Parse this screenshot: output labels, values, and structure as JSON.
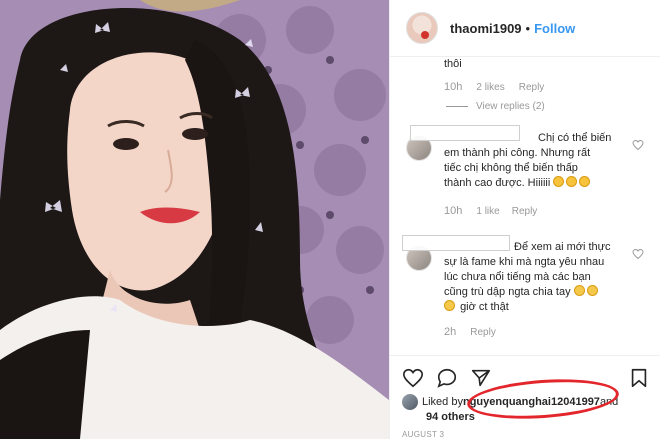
{
  "header": {
    "username": "thaomi1909",
    "separator": "•",
    "follow_label": "Follow"
  },
  "comments": [
    {
      "text_lines": [
        "thôi"
      ],
      "time": "10h",
      "likes": "2 likes",
      "reply": "Reply",
      "view_replies": "View replies (2)"
    },
    {
      "text_lines": [
        "Chị có thể biến",
        "em thành phi công. Nhưng rất",
        "tiếc chị không thể biến thấp",
        "thành cao được. Hiiiiii"
      ],
      "time": "10h",
      "likes": "1 like",
      "reply": "Reply"
    },
    {
      "text_lines": [
        "Để xem ai mới thực",
        "sự là fame khi mà ngta yêu nhau",
        "lúc chưa nổi tiếng mà các bạn",
        "cũng trù dập ngta chia tay",
        "giờ ct thật"
      ],
      "time": "2h",
      "reply": "Reply"
    }
  ],
  "liked": {
    "prefix": "Liked by ",
    "user": "nguyenquanghai12041997",
    "and": " and",
    "others": "94 others"
  },
  "date": "AUGUST 3",
  "colors": {
    "follow": "#3897f0",
    "annotation": "#e3262b"
  },
  "icons": [
    "heart-icon",
    "comment-icon",
    "share-icon",
    "bookmark-icon"
  ]
}
